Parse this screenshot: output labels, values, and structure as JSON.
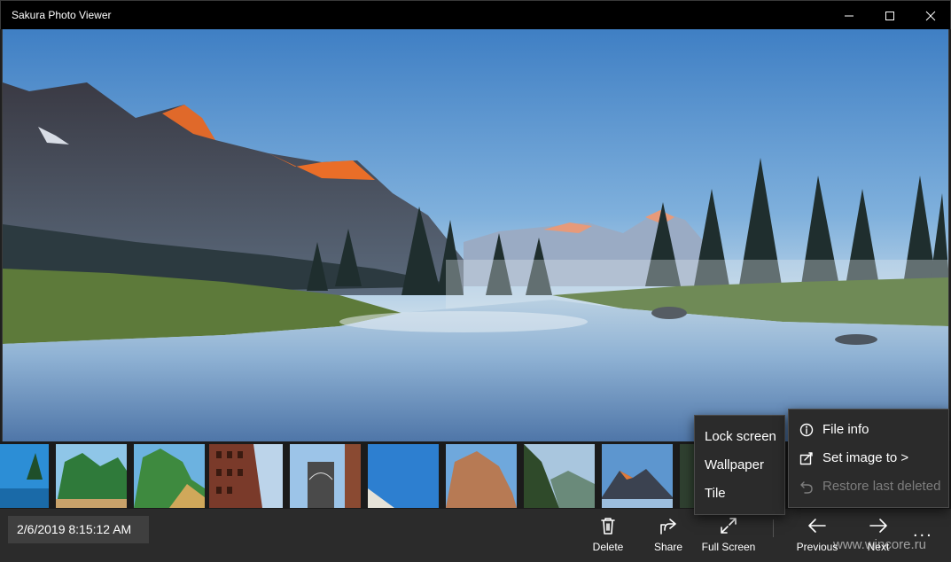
{
  "window": {
    "title": "Sakura Photo Viewer"
  },
  "status": {
    "datetime": "2/6/2019 8:15:12 AM"
  },
  "toolbar": {
    "delete_label": "Delete",
    "share_label": "Share",
    "fullscreen_label": "Full Screen",
    "previous_label": "Previous",
    "next_label": "Next",
    "more_label": "..."
  },
  "set_image_menu": {
    "items": [
      {
        "label": "Lock screen"
      },
      {
        "label": "Wallpaper"
      },
      {
        "label": "Tile"
      }
    ]
  },
  "more_menu": {
    "file_info": "File info",
    "set_image_to": "Set image to >",
    "restore_last_deleted": "Restore last deleted"
  },
  "watermark": "www.wincore.ru",
  "colors": {
    "titlebar": "#000000",
    "bottombar": "#2b2b2b",
    "menu_bg": "#2b2b2b",
    "disabled_text": "#7d7d7d"
  },
  "icons": [
    "minimize-icon",
    "maximize-icon",
    "close-icon",
    "trash-icon",
    "share-icon",
    "fullscreen-icon",
    "arrow-left-icon",
    "arrow-right-icon",
    "info-icon",
    "set-image-icon",
    "restore-icon"
  ]
}
